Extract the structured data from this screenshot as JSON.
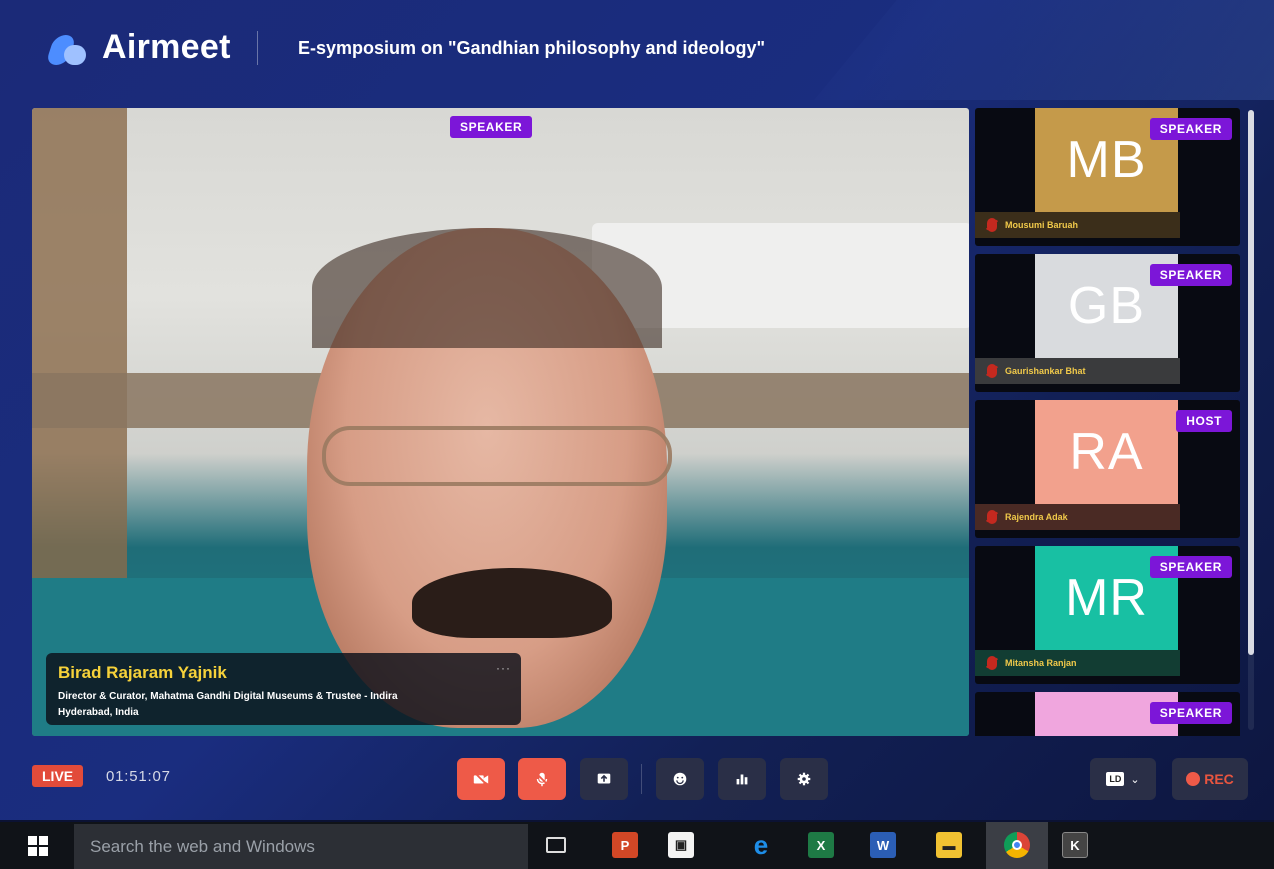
{
  "header": {
    "brand": "Airmeet",
    "event_title": "E-symposium on \"Gandhian philosophy and ideology\""
  },
  "main_stage": {
    "badge": "SPEAKER",
    "speaker_name": "Birad Rajaram Yajnik",
    "speaker_desc_line1": "Director & Curator, Mahatma Gandhi Digital Museums & Trustee - Indira",
    "speaker_desc_line2": "Hyderabad, India",
    "more": "···"
  },
  "side_tiles": [
    {
      "initials": "MB",
      "name": "Mousumi Baruah",
      "badge": "SPEAKER",
      "color": "#c59a4a"
    },
    {
      "initials": "GB",
      "name": "Gaurishankar Bhat",
      "badge": "SPEAKER",
      "color": "#d9dbde"
    },
    {
      "initials": "RA",
      "name": "Rajendra Adak",
      "badge": "HOST",
      "color": "#f2a18d"
    },
    {
      "initials": "MR",
      "name": "Mitansha Ranjan",
      "badge": "SPEAKER",
      "color": "#18c0a3"
    },
    {
      "initials": "",
      "name": "",
      "badge": "SPEAKER",
      "color": "#f0a6de"
    }
  ],
  "controls": {
    "live_label": "LIVE",
    "timer": "01:51:07",
    "quality_label": "LD",
    "rec_label": "REC"
  },
  "taskbar": {
    "search_placeholder": "Search the web and Windows"
  },
  "colors": {
    "speaker_badge": "#7c16d8",
    "live_red": "#e24b3a",
    "name_yellow": "#f6d23a"
  }
}
